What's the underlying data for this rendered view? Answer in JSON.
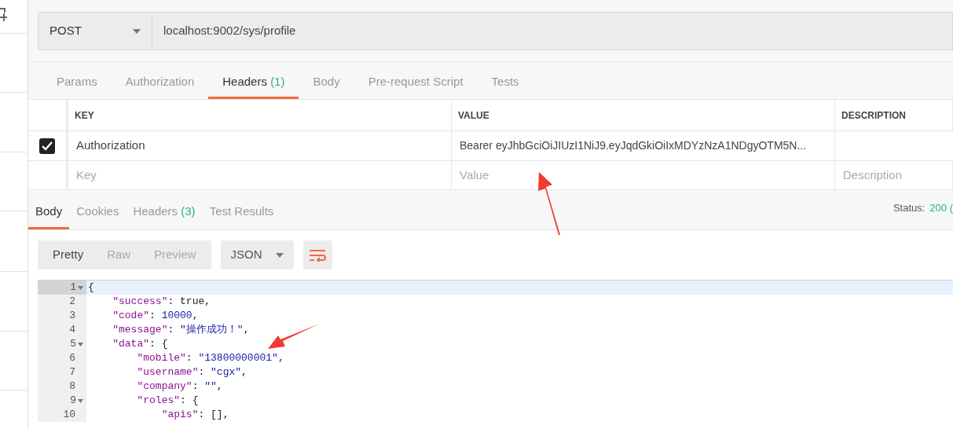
{
  "request": {
    "method": "POST",
    "url": "localhost:9002/sys/profile"
  },
  "request_tabs": [
    {
      "label": "Params",
      "selected": false
    },
    {
      "label": "Authorization",
      "selected": false
    },
    {
      "label": "Headers",
      "count": "(1)",
      "selected": true
    },
    {
      "label": "Body",
      "selected": false
    },
    {
      "label": "Pre-request Script",
      "selected": false
    },
    {
      "label": "Tests",
      "selected": false
    }
  ],
  "headers_table": {
    "columns": [
      "KEY",
      "VALUE",
      "DESCRIPTION"
    ],
    "rows": [
      {
        "checked": true,
        "key": "Authorization",
        "value": "Bearer eyJhbGciOiJIUzI1NiJ9.eyJqdGkiOiIxMDYzNzA1NDgyOTM5N..."
      }
    ],
    "new_row": {
      "key_placeholder": "Key",
      "value_placeholder": "Value",
      "description_placeholder": "Description"
    }
  },
  "response_tabs": [
    {
      "label": "Body",
      "selected": true
    },
    {
      "label": "Cookies",
      "selected": false
    },
    {
      "label": "Headers",
      "count": "(3)",
      "selected": false
    },
    {
      "label": "Test Results",
      "selected": false
    }
  ],
  "status": {
    "label": "Status:",
    "value": "200 ("
  },
  "view_modes": [
    {
      "label": "Pretty",
      "selected": true
    },
    {
      "label": "Raw",
      "selected": false
    },
    {
      "label": "Preview",
      "selected": false
    }
  ],
  "format": "JSON",
  "code_lines": [
    {
      "number": "1",
      "text": "{",
      "foldable": true,
      "selected": true
    },
    {
      "number": "2",
      "text": "    \"success\": true,",
      "foldable": false,
      "selected": false
    },
    {
      "number": "3",
      "text": "    \"code\": 10000,",
      "foldable": false,
      "selected": false
    },
    {
      "number": "4",
      "text": "    \"message\": \"操作成功！\",",
      "foldable": false,
      "selected": false
    },
    {
      "number": "5",
      "text": "    \"data\": {",
      "foldable": true,
      "selected": false
    },
    {
      "number": "6",
      "text": "        \"mobile\": \"13800000001\",",
      "foldable": false,
      "selected": false
    },
    {
      "number": "7",
      "text": "        \"username\": \"cgx\",",
      "foldable": false,
      "selected": false
    },
    {
      "number": "8",
      "text": "        \"company\": \"\",",
      "foldable": false,
      "selected": false
    },
    {
      "number": "9",
      "text": "        \"roles\": {",
      "foldable": true,
      "selected": false
    },
    {
      "number": "10",
      "text": "            \"apis\": [],",
      "foldable": false,
      "selected": false
    }
  ]
}
